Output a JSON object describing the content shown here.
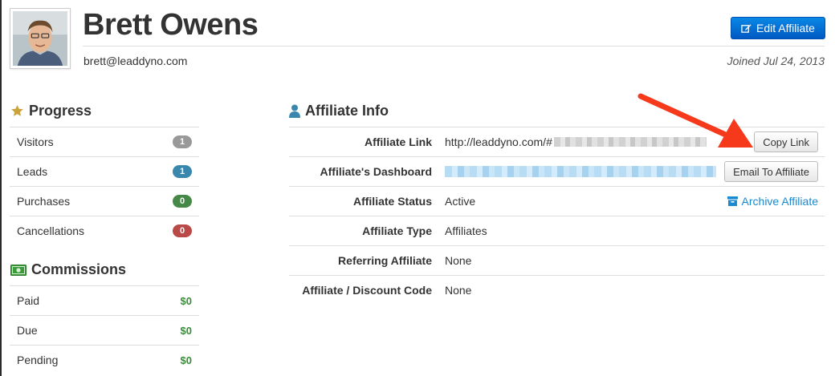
{
  "profile": {
    "name": "Brett Owens",
    "email": "brett@leaddyno.com",
    "joined": "Joined Jul 24, 2013",
    "edit_button": "Edit Affiliate"
  },
  "progress": {
    "title": "Progress",
    "items": [
      {
        "label": "Visitors",
        "count": "1",
        "color": "#999999"
      },
      {
        "label": "Leads",
        "count": "1",
        "color": "#3a87ad"
      },
      {
        "label": "Purchases",
        "count": "0",
        "color": "#468847"
      },
      {
        "label": "Cancellations",
        "count": "0",
        "color": "#b94a48"
      }
    ]
  },
  "commissions": {
    "title": "Commissions",
    "items": [
      {
        "label": "Paid",
        "amount": "$0"
      },
      {
        "label": "Due",
        "amount": "$0"
      },
      {
        "label": "Pending",
        "amount": "$0"
      }
    ]
  },
  "affiliate_info": {
    "title": "Affiliate Info",
    "rows": [
      {
        "label": "Affiliate Link",
        "value": "http://leaddyno.com/#"
      },
      {
        "label": "Affiliate's Dashboard",
        "value": ""
      },
      {
        "label": "Affiliate Status",
        "value": "Active"
      },
      {
        "label": "Affiliate Type",
        "value": "Affiliates"
      },
      {
        "label": "Referring Affiliate",
        "value": "None"
      },
      {
        "label": "Affiliate / Discount Code",
        "value": "None"
      }
    ],
    "copy_link_button": "Copy Link",
    "email_button": "Email To Affiliate",
    "archive_link": "Archive Affiliate"
  },
  "colors": {
    "accent": "#0a6fd8",
    "link": "#1a8ad0",
    "money": "#3a8a3a",
    "arrow": "#f5391a"
  },
  "icons": {
    "edit": "edit-icon",
    "progress": "star-icon",
    "commissions": "money-icon",
    "info": "user-icon",
    "archive": "archive-icon"
  }
}
